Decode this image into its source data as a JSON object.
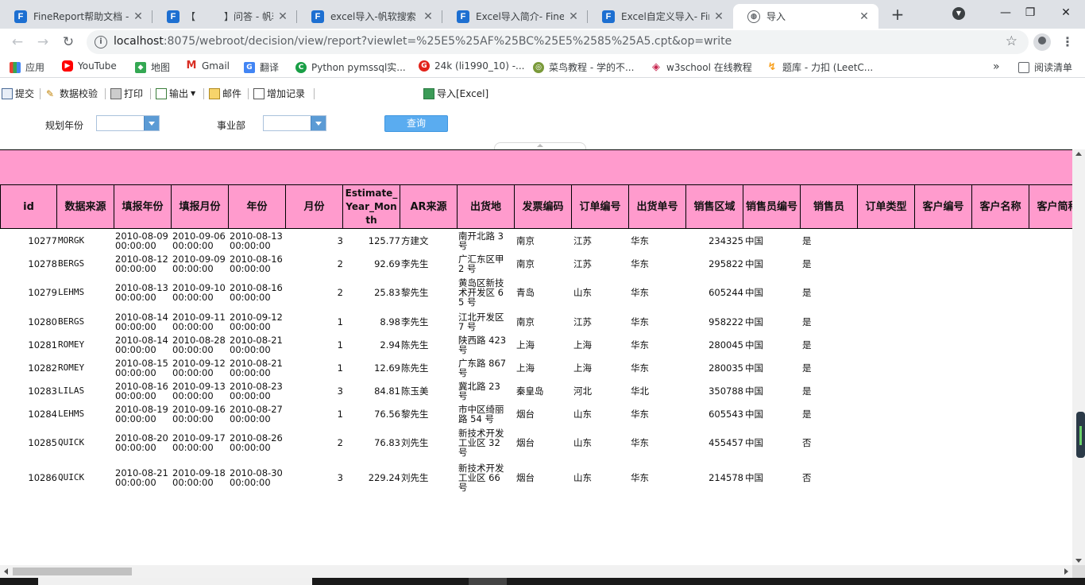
{
  "browser": {
    "tabs": [
      {
        "label": "FineReport帮助文档 -",
        "icon": "F",
        "active": false
      },
      {
        "label": "【　　　】问答 - 帆软",
        "icon": "F",
        "active": false
      },
      {
        "label": "excel导入-帆软搜索",
        "icon": "F",
        "active": false
      },
      {
        "label": "Excel导入简介- FineR",
        "icon": "F",
        "active": false
      },
      {
        "label": "Excel自定义导入- Fine",
        "icon": "F",
        "active": false
      },
      {
        "label": "导入",
        "icon": "globe-icon",
        "active": true
      }
    ],
    "tab_close": "✕",
    "new_tab": "+",
    "window_controls": {
      "minimize": "—",
      "maximize": "❐",
      "close": "✕"
    },
    "url_host": "localhost",
    "url_rest": ":8075/webroot/decision/view/report?viewlet=%25E5%25AF%25BC%25E5%2585%25A5.cpt&op=write",
    "bookmarks": [
      {
        "label": "应用",
        "icon": "apps-grid-icon"
      },
      {
        "label": "YouTube",
        "icon": "youtube-icon"
      },
      {
        "label": "地图",
        "icon": "maps-icon"
      },
      {
        "label": "Gmail",
        "icon": "gmail-icon"
      },
      {
        "label": "翻译",
        "icon": "translate-icon"
      },
      {
        "label": "Python pymssql实...",
        "icon": "c-icon"
      },
      {
        "label": "24k (li1990_10) -...",
        "icon": "g-icon"
      },
      {
        "label": "菜鸟教程 - 学的不...",
        "icon": "runoob-icon"
      },
      {
        "label": "w3school 在线教程",
        "icon": "w3school-icon"
      },
      {
        "label": "题库 - 力扣 (LeetC...",
        "icon": "leetcode-icon"
      }
    ],
    "bookmarks_overflow": "»",
    "reading_list": "阅读清单"
  },
  "toolbar": {
    "submit": "提交",
    "validate": "数据校验",
    "print": "打印",
    "export": "输出",
    "email": "邮件",
    "add_record": "增加记录",
    "import_excel": "导入[Excel]"
  },
  "params": {
    "year_label": "规划年份",
    "year_value": "",
    "dept_label": "事业部",
    "dept_value": "",
    "query_button": "查询"
  },
  "table": {
    "headers": [
      "id",
      "数据来源",
      "填报年份",
      "填报月份",
      "年份",
      "月份",
      "Estimate_\nYear_Mon\nth",
      "AR来源",
      "出货地",
      "发票编码",
      "订单编号",
      "出货单号",
      "销售区域",
      "销售员编号",
      "销售员",
      "订单类型",
      "客户编号",
      "客户名称",
      "客户简称"
    ],
    "rows": [
      {
        "id": "10277",
        "src": "MORGK",
        "d1": "2010-08-09 00:00:00",
        "d2": "2010-09-06 00:00:00",
        "d3": "2010-08-13 00:00:00",
        "n": "3",
        "amt": "125.77",
        "name": "方建文",
        "addr": "南开北路 3 号",
        "city": "南京",
        "prov": "江苏",
        "region": "华东",
        "code": "234325",
        "country": "中国",
        "flag": "是"
      },
      {
        "id": "10278",
        "src": "BERGS",
        "d1": "2010-08-12 00:00:00",
        "d2": "2010-09-09 00:00:00",
        "d3": "2010-08-16 00:00:00",
        "n": "2",
        "amt": "92.69",
        "name": "李先生",
        "addr": "广汇东区甲 2 号",
        "city": "南京",
        "prov": "江苏",
        "region": "华东",
        "code": "295822",
        "country": "中国",
        "flag": "是"
      },
      {
        "id": "10279",
        "src": "LEHMS",
        "d1": "2010-08-13 00:00:00",
        "d2": "2010-09-10 00:00:00",
        "d3": "2010-08-16 00:00:00",
        "n": "2",
        "amt": "25.83",
        "name": "黎先生",
        "addr": "黄岛区新技术开发区 65 号",
        "city": "青岛",
        "prov": "山东",
        "region": "华东",
        "code": "605244",
        "country": "中国",
        "flag": "是"
      },
      {
        "id": "10280",
        "src": "BERGS",
        "d1": "2010-08-14 00:00:00",
        "d2": "2010-09-11 00:00:00",
        "d3": "2010-09-12 00:00:00",
        "n": "1",
        "amt": "8.98",
        "name": "李先生",
        "addr": "江北开发区 7 号",
        "city": "南京",
        "prov": "江苏",
        "region": "华东",
        "code": "958222",
        "country": "中国",
        "flag": "是"
      },
      {
        "id": "10281",
        "src": "ROMEY",
        "d1": "2010-08-14 00:00:00",
        "d2": "2010-08-28 00:00:00",
        "d3": "2010-08-21 00:00:00",
        "n": "1",
        "amt": "2.94",
        "name": "陈先生",
        "addr": "陕西路 423 号",
        "city": "上海",
        "prov": "上海",
        "region": "华东",
        "code": "280045",
        "country": "中国",
        "flag": "是"
      },
      {
        "id": "10282",
        "src": "ROMEY",
        "d1": "2010-08-15 00:00:00",
        "d2": "2010-09-12 00:00:00",
        "d3": "2010-08-21 00:00:00",
        "n": "1",
        "amt": "12.69",
        "name": "陈先生",
        "addr": "广东路 867 号",
        "city": "上海",
        "prov": "上海",
        "region": "华东",
        "code": "280035",
        "country": "中国",
        "flag": "是"
      },
      {
        "id": "10283",
        "src": "LILAS",
        "d1": "2010-08-16 00:00:00",
        "d2": "2010-09-13 00:00:00",
        "d3": "2010-08-23 00:00:00",
        "n": "3",
        "amt": "84.81",
        "name": "陈玉美",
        "addr": "冀北路 23 号",
        "city": "秦皇岛",
        "prov": "河北",
        "region": "华北",
        "code": "350788",
        "country": "中国",
        "flag": "是"
      },
      {
        "id": "10284",
        "src": "LEHMS",
        "d1": "2010-08-19 00:00:00",
        "d2": "2010-09-16 00:00:00",
        "d3": "2010-08-27 00:00:00",
        "n": "1",
        "amt": "76.56",
        "name": "黎先生",
        "addr": "市中区绮丽路 54 号",
        "city": "烟台",
        "prov": "山东",
        "region": "华东",
        "code": "605543",
        "country": "中国",
        "flag": "是"
      },
      {
        "id": "10285",
        "src": "QUICK",
        "d1": "2010-08-20 00:00:00",
        "d2": "2010-09-17 00:00:00",
        "d3": "2010-08-26 00:00:00",
        "n": "2",
        "amt": "76.83",
        "name": "刘先生",
        "addr": "新技术开发工业区 32 号",
        "city": "烟台",
        "prov": "山东",
        "region": "华东",
        "code": "455457",
        "country": "中国",
        "flag": "否"
      },
      {
        "id": "10286",
        "src": "QUICK",
        "d1": "2010-08-21 00:00:00",
        "d2": "2010-09-18 00:00:00",
        "d3": "2010-08-30 00:00:00",
        "n": "3",
        "amt": "229.24",
        "name": "刘先生",
        "addr": "新技术开发工业区 66 号",
        "city": "烟台",
        "prov": "山东",
        "region": "华东",
        "code": "214578",
        "country": "中国",
        "flag": "否"
      }
    ]
  },
  "colors": {
    "header_fill": "#ff9bcd",
    "query_button": "#5aacf0",
    "combo_arrow": "#5b9bd5",
    "chrome_tabstrip": "#dee1e6"
  }
}
